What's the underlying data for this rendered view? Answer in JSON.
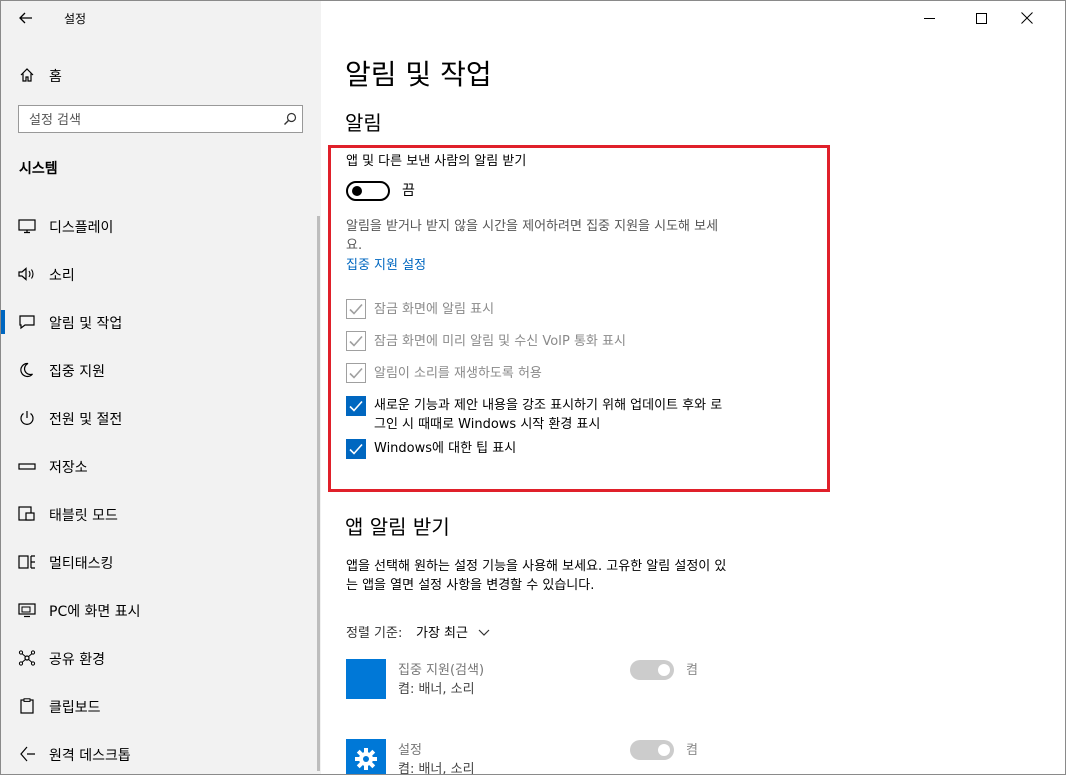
{
  "window": {
    "title": "설정"
  },
  "sidebar": {
    "home_label": "홈",
    "search_placeholder": "설정 검색",
    "section": "시스템",
    "items": [
      {
        "label": "디스플레이",
        "icon": "display-icon"
      },
      {
        "label": "소리",
        "icon": "speaker-icon"
      },
      {
        "label": "알림 및 작업",
        "icon": "notification-icon",
        "active": true
      },
      {
        "label": "집중 지원",
        "icon": "moon-icon"
      },
      {
        "label": "전원 및 절전",
        "icon": "power-icon"
      },
      {
        "label": "저장소",
        "icon": "storage-icon"
      },
      {
        "label": "태블릿 모드",
        "icon": "tablet-icon"
      },
      {
        "label": "멀티태스킹",
        "icon": "multitasking-icon"
      },
      {
        "label": "PC에 화면 표시",
        "icon": "project-icon"
      },
      {
        "label": "공유 환경",
        "icon": "share-icon"
      },
      {
        "label": "클립보드",
        "icon": "clipboard-icon"
      },
      {
        "label": "원격 데스크톱",
        "icon": "remote-desktop-icon"
      }
    ]
  },
  "main": {
    "title": "알림 및 작업",
    "notifications": {
      "heading": "알림",
      "get_notifications_label": "앱 및 다른 보낸 사람의 알림 받기",
      "toggle_state": "끔",
      "focus_desc": "알림을 받거나 받지 않을 시간을 제어하려면 집중 지원을 시도해 보세요.",
      "focus_desc_line1": "알림을 받거나 받지 않을 시간을 제어하려면 집중 지원을 시도해 보세",
      "focus_desc_line2": "요.",
      "focus_link": "집중 지원 설정",
      "checkboxes": [
        {
          "label": "잠금 화면에 알림 표시",
          "checked": true,
          "disabled": true
        },
        {
          "label": "잠금 화면에 미리 알림 및 수신 VoIP 통화 표시",
          "checked": true,
          "disabled": true
        },
        {
          "label": "알림이 소리를 재생하도록 허용",
          "checked": true,
          "disabled": true
        },
        {
          "label_line1": "새로운 기능과 제안 내용을 강조 표시하기 위해 업데이트 후와 로",
          "label_line2": "그인 시 때때로 Windows 시작 환경 표시",
          "checked": true,
          "disabled": false
        },
        {
          "label": "Windows에 대한 팁 표시",
          "checked": true,
          "disabled": false
        }
      ]
    },
    "app_notifications": {
      "heading": "앱 알림 받기",
      "desc_line1": "앱을 선택해 원하는 설정 기능을 사용해 보세요. 고유한 알림 설정이 있",
      "desc_line2": "는 앱을 열면 설정 사항을 변경할 수 있습니다.",
      "sort_label": "정렬 기준:",
      "sort_value": "가장 최근",
      "apps": [
        {
          "name": "집중 지원(검색)",
          "sub": "켬: 배너, 소리",
          "toggle": "켬"
        },
        {
          "name": "설정",
          "sub": "켬: 배너, 소리",
          "toggle": "켬"
        }
      ]
    }
  },
  "colors": {
    "accent": "#0067c0",
    "highlight_box": "#e0202a",
    "sidebar_bg": "#f2f2f2"
  }
}
